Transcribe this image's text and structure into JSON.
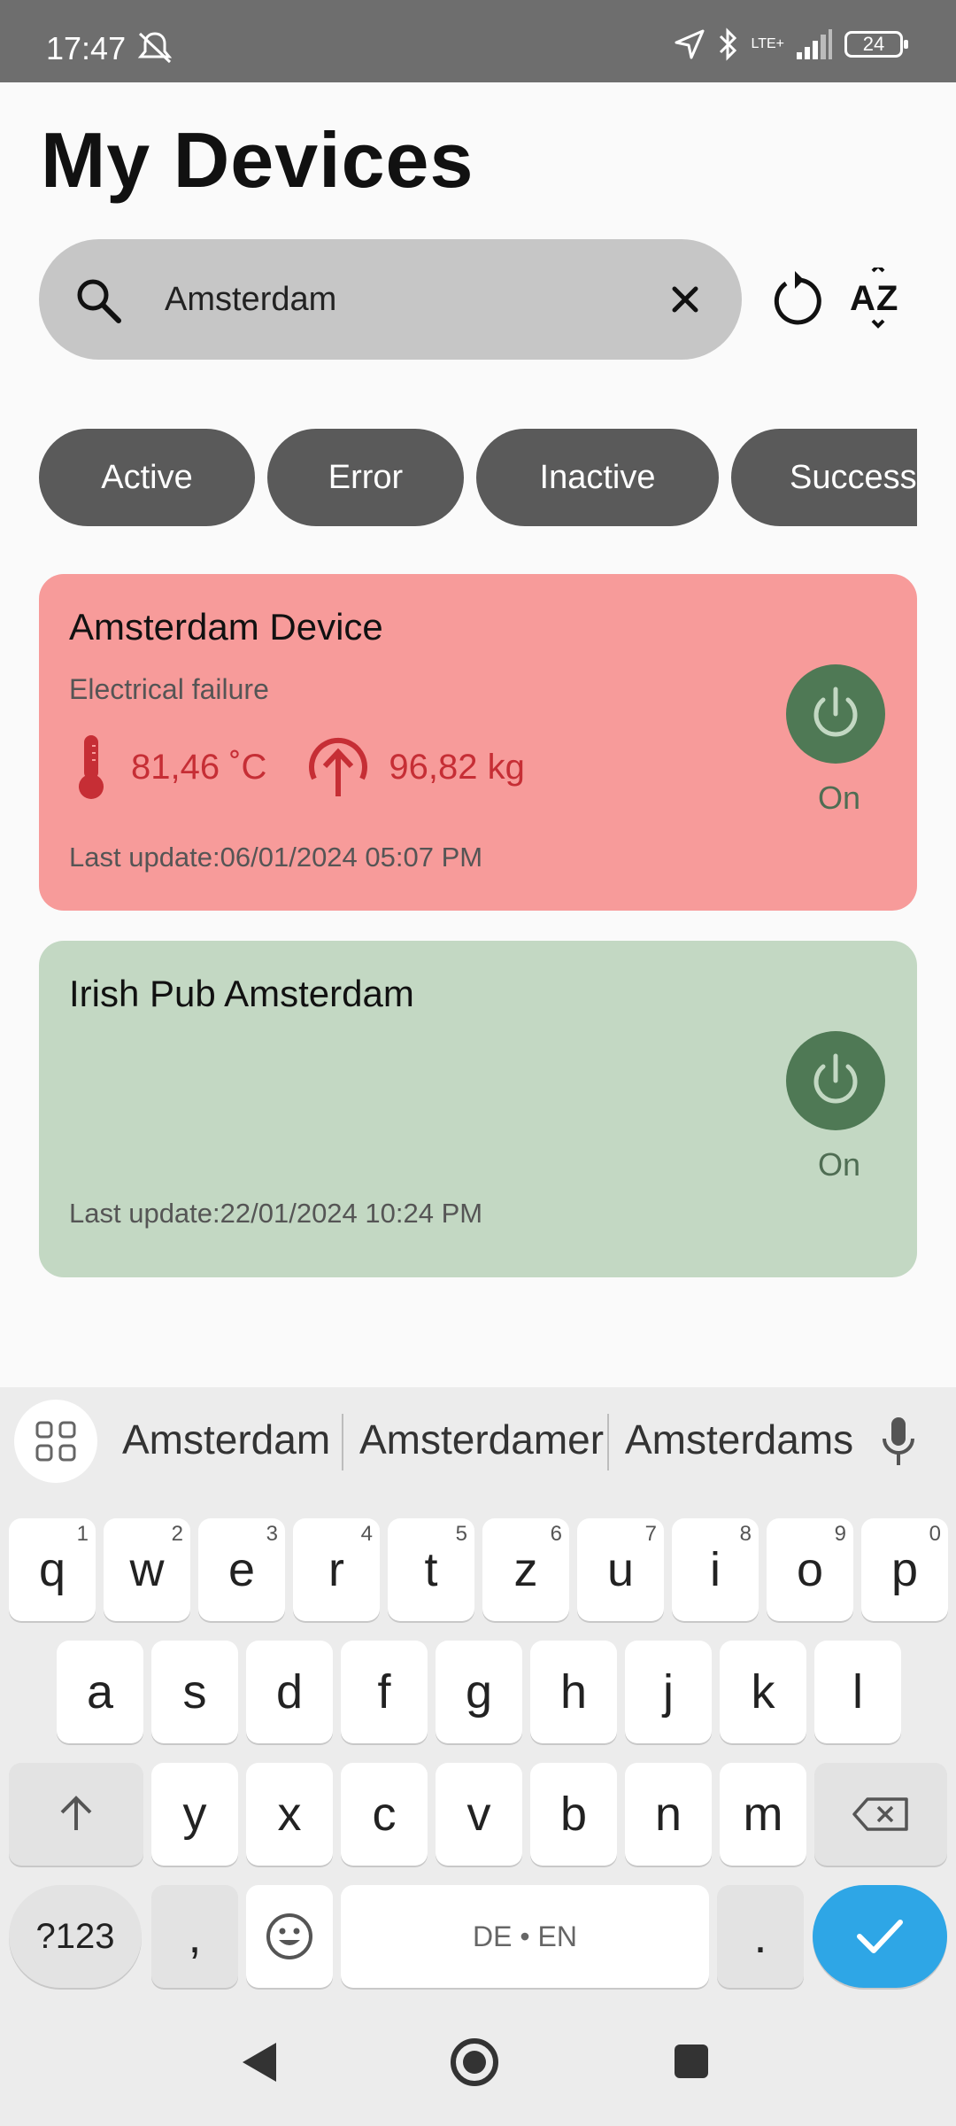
{
  "status_bar": {
    "time": "17:47",
    "network": "LTE+",
    "battery": "24",
    "icons": [
      "mute-icon",
      "location-icon",
      "bluetooth-icon",
      "signal-icon",
      "battery-icon"
    ]
  },
  "header": {
    "title": "My Devices"
  },
  "search": {
    "value": "Amsterdam",
    "placeholder": ""
  },
  "filters": [
    {
      "label": "Active"
    },
    {
      "label": "Error"
    },
    {
      "label": "Inactive"
    },
    {
      "label": "Success"
    }
  ],
  "devices": [
    {
      "name": "Amsterdam Device",
      "status_text": "Electrical failure",
      "temperature": "81,46 ˚C",
      "weight": "96,82 kg",
      "last_update": "Last update:06/01/2024 05:07 PM",
      "power_label": "On",
      "status_color": "#f79b9a"
    },
    {
      "name": "Irish Pub Amsterdam",
      "last_update": "Last update:22/01/2024 10:24 PM",
      "power_label": "On",
      "status_color": "#c3d8c3"
    }
  ],
  "keyboard": {
    "suggestions": [
      "Amsterdam",
      "Amsterdamer",
      "Amsterdams"
    ],
    "row1": [
      {
        "key": "q",
        "hint": "1"
      },
      {
        "key": "w",
        "hint": "2"
      },
      {
        "key": "e",
        "hint": "3"
      },
      {
        "key": "r",
        "hint": "4"
      },
      {
        "key": "t",
        "hint": "5"
      },
      {
        "key": "z",
        "hint": "6"
      },
      {
        "key": "u",
        "hint": "7"
      },
      {
        "key": "i",
        "hint": "8"
      },
      {
        "key": "o",
        "hint": "9"
      },
      {
        "key": "p",
        "hint": "0"
      }
    ],
    "row2": [
      "a",
      "s",
      "d",
      "f",
      "g",
      "h",
      "j",
      "k",
      "l"
    ],
    "row3": [
      "y",
      "x",
      "c",
      "v",
      "b",
      "n",
      "m"
    ],
    "symbols_label": "?123",
    "comma": ",",
    "space_label": "DE • EN",
    "period": ".",
    "accent_color": "#2ea6e6"
  }
}
